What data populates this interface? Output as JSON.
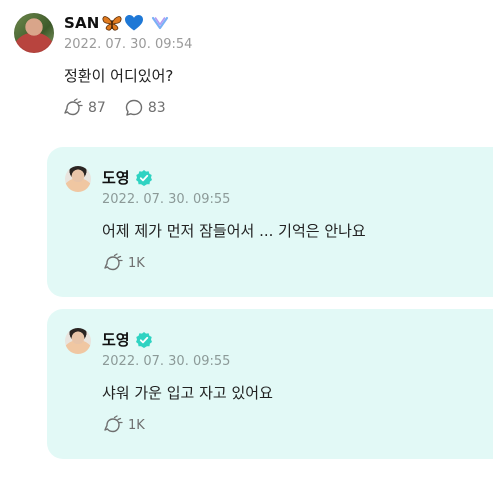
{
  "post": {
    "author": "SAN",
    "timestamp": "2022. 07. 30. 09:54",
    "text": "정환이 어디있어?",
    "likes": "87",
    "comments": "83",
    "badges": [
      "butterfly-emoji",
      "blue-heart-emoji",
      "weverse-logo-icon"
    ]
  },
  "replies": [
    {
      "author": "도영",
      "verified": true,
      "timestamp": "2022. 07. 30. 09:55",
      "text": "어제 제가 먼저 잠들어서 ... 기억은 안나요",
      "likes": "1K"
    },
    {
      "author": "도영",
      "verified": true,
      "timestamp": "2022. 07. 30. 09:55",
      "text": "샤워 가운 입고 자고 있어요",
      "likes": "1K"
    }
  ],
  "colors": {
    "reply_background": "#e2f9f6",
    "verified_badge": "#2fd3c2",
    "heart": "#1e78d6",
    "butterfly": "#e07a1f",
    "weverse_logo": "#7ab1f5"
  }
}
